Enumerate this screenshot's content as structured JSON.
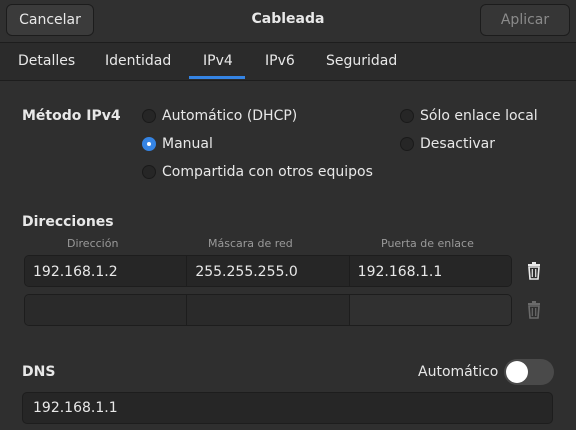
{
  "header": {
    "cancel_label": "Cancelar",
    "title": "Cableada",
    "apply_label": "Aplicar"
  },
  "tabs": [
    {
      "label": "Detalles"
    },
    {
      "label": "Identidad"
    },
    {
      "label": "IPv4",
      "active": true
    },
    {
      "label": "IPv6"
    },
    {
      "label": "Seguridad"
    }
  ],
  "ipv4": {
    "method_label": "Método IPv4",
    "options": [
      {
        "label": "Automático (DHCP)",
        "checked": false
      },
      {
        "label": "Manual",
        "checked": true
      },
      {
        "label": "Compartida con otros equipos",
        "checked": false
      },
      {
        "label": "Sólo enlace local",
        "checked": false
      },
      {
        "label": "Desactivar",
        "checked": false
      }
    ]
  },
  "addresses": {
    "title": "Direcciones",
    "columns": [
      "Dirección",
      "Máscara de red",
      "Puerta de enlace"
    ],
    "rows": [
      [
        "192.168.1.2",
        "255.255.255.0",
        "192.168.1.1"
      ],
      [
        "",
        "",
        ""
      ]
    ]
  },
  "dns": {
    "title": "DNS",
    "auto_label": "Automático",
    "auto_enabled": false,
    "value": "192.168.1.1"
  },
  "colors": {
    "accent": "#3584e4",
    "background": "#2f2f2f"
  }
}
